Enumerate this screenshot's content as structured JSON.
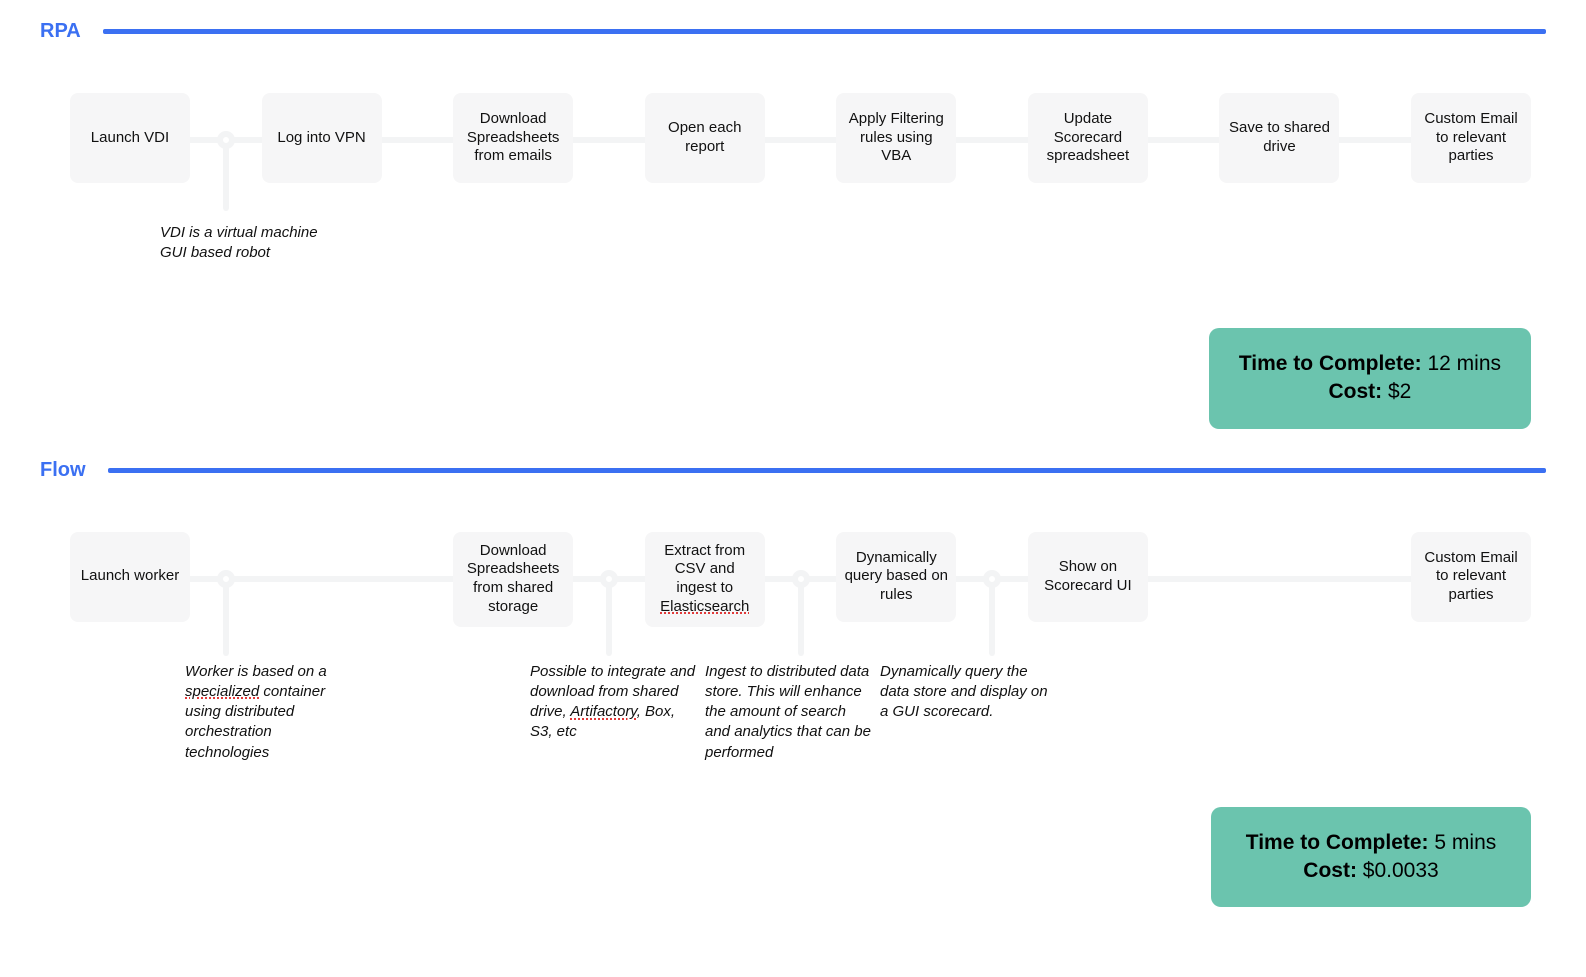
{
  "sections": {
    "rpa": {
      "label": "RPA",
      "steps": [
        "Launch VDI",
        "Log into VPN",
        "Download Spreadsheets from emails",
        "Open each report",
        "Apply Filtering rules using VBA",
        "Update Scorecard spreadsheet",
        "Save to shared drive",
        "Custom Email to relevant parties"
      ],
      "note_vdi": "VDI is a virtual machine GUI based robot",
      "result": {
        "time_label": "Time to Complete:",
        "time_value": "12 mins",
        "cost_label": "Cost:",
        "cost_value": "$2"
      }
    },
    "flow": {
      "label": "Flow",
      "steps": [
        "Launch worker",
        "",
        "Download Spreadsheets from shared storage",
        "Extract from CSV and ingest to Elasticsearch",
        "Dynamically query based on rules",
        "Show on Scorecard UI",
        "",
        "Custom Email to relevant parties"
      ],
      "notes": {
        "worker_pre": "Worker is based on a ",
        "worker_sp": "specialized",
        "worker_post": " container using distributed orchestration technologies",
        "download_pre": "Possible to integrate and download from shared drive, ",
        "download_sp": "Artifactory",
        "download_post": ", Box, S3, etc",
        "ingest": "Ingest to distributed data store. This will enhance the amount of search and analytics that can be performed",
        "query": "Dynamically query the data store and display on a GUI scorecard."
      },
      "result": {
        "time_label": "Time to Complete:",
        "time_value": "5 mins",
        "cost_label": "Cost:",
        "cost_value": "$0.0033"
      }
    }
  },
  "spellcheck_word": "Elasticsearch"
}
